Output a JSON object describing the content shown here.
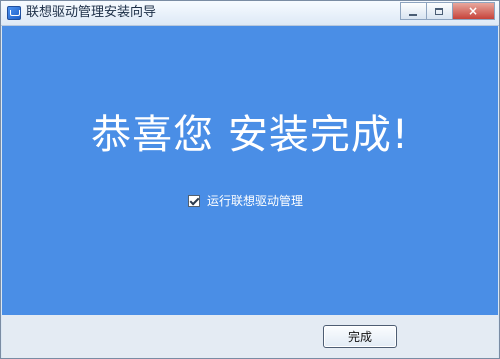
{
  "window": {
    "title": "联想驱动管理安装向导"
  },
  "main": {
    "headline": "恭喜您  安装完成!",
    "checkbox": {
      "label": "运行联想驱动管理",
      "checked": true
    }
  },
  "footer": {
    "finish_label": "完成"
  },
  "icons": {
    "app": "installer-icon",
    "minimize": "minimize-icon",
    "maximize": "maximize-icon",
    "close": "close-icon",
    "checkmark": "checkmark-icon"
  },
  "colors": {
    "content_background": "#4a8ee6",
    "footer_background": "#e4ebf3",
    "headline_text": "#ffffff",
    "close_button": "#c6433a"
  }
}
